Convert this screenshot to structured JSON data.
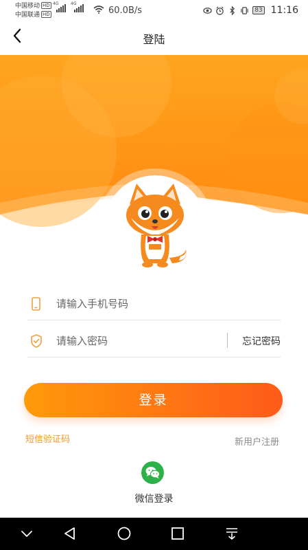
{
  "status_bar": {
    "carrier1": "中国移动",
    "carrier2": "中国联通",
    "hd1": "HD",
    "hd2": "HD",
    "net1": "4G",
    "net2": "4G",
    "net_speed": "60.0B/s",
    "battery": "83",
    "time": "11:16"
  },
  "header": {
    "title": "登陆"
  },
  "form": {
    "phone_placeholder": "请输入手机号码",
    "password_placeholder": "请输入密码",
    "forgot_label": "忘记密码"
  },
  "login_button": "登录",
  "links": {
    "sms": "短信验证码",
    "register": "新用户注册"
  },
  "wechat": {
    "label": "微信登录"
  },
  "colors": {
    "accent": "#ff7a10",
    "accent_light": "#ffa21a",
    "link_orange": "#f19a30",
    "wechat_green": "#2fb14a"
  },
  "icons": {
    "back": "back-arrow-icon",
    "phone": "phone-icon",
    "shield": "shield-check-icon",
    "wechat": "wechat-icon",
    "mascot": "fox-mascot"
  }
}
